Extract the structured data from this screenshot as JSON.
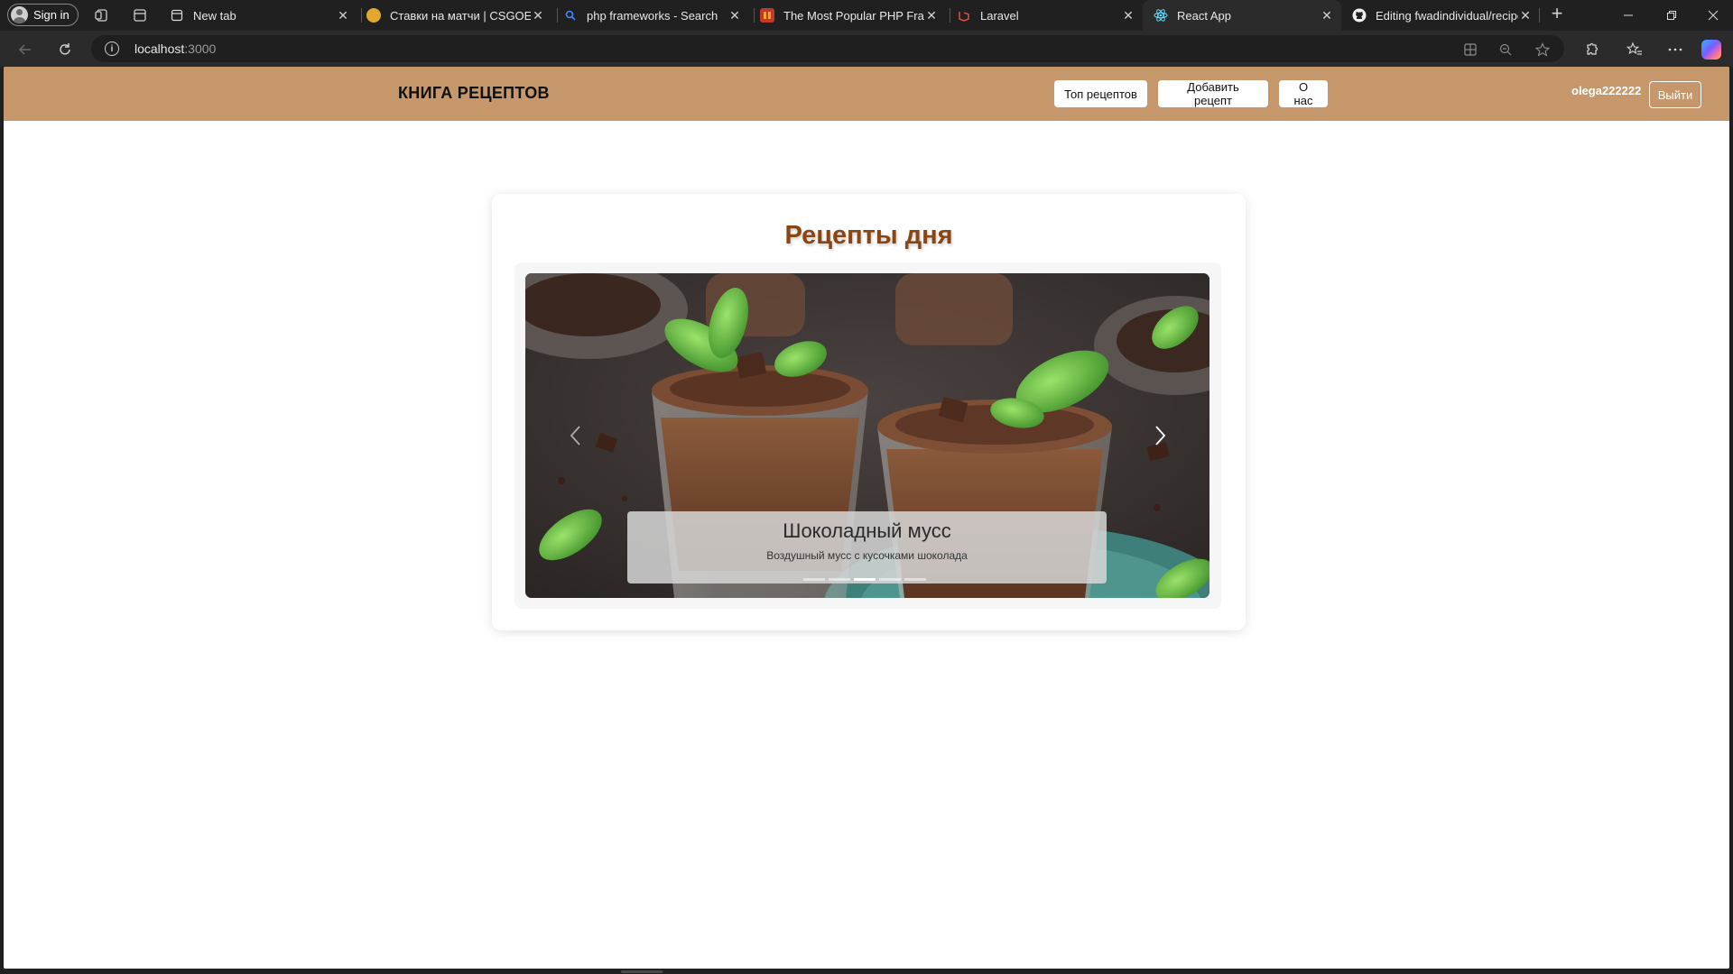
{
  "browser": {
    "signin_label": "Sign in",
    "tabs": [
      {
        "label": "New tab",
        "favicon": "page-icon",
        "active": false
      },
      {
        "label": "Ставки на матчи | CSGOEmpire",
        "favicon": "csgoempire-icon",
        "active": false
      },
      {
        "label": "php frameworks - Search",
        "favicon": "search-icon",
        "active": false
      },
      {
        "label": "The Most Popular PHP Frameworks",
        "favicon": "article-icon",
        "active": false
      },
      {
        "label": "Laravel",
        "favicon": "laravel-icon",
        "active": false
      },
      {
        "label": "React App",
        "favicon": "react-icon",
        "active": true
      },
      {
        "label": "Editing fwadindividual/recipe",
        "favicon": "github-icon",
        "active": false
      }
    ],
    "url_host": "localhost",
    "url_port": ":3000"
  },
  "app": {
    "logo": "КНИГА РЕЦЕПТОВ",
    "nav": {
      "top_recipes": "Топ рецептов",
      "add_recipe": "Добавить рецепт",
      "about": "О нас"
    },
    "username": "olega222222",
    "logout": "Выйти",
    "header_color": "#c5976a",
    "title_color": "#8b4513"
  },
  "main": {
    "title": "Рецепты дня",
    "carousel": {
      "slide_count": 5,
      "active_index": 2,
      "current": {
        "title": "Шоколадный мусс",
        "description": "Воздушный мусс с кусочками шоколада"
      }
    }
  }
}
